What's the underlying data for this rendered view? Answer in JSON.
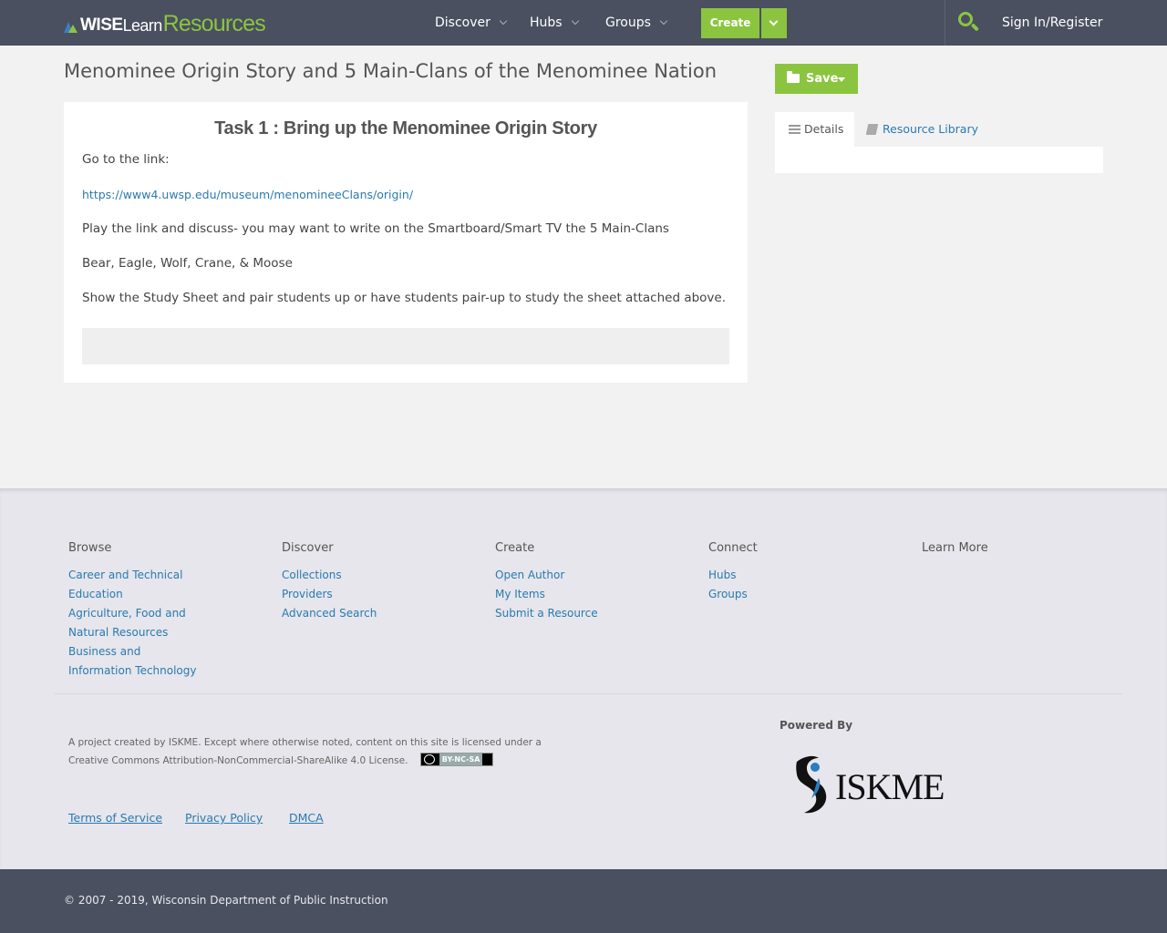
{
  "header": {
    "logo": {
      "wise": "WISE",
      "learn": "Learn",
      "resources": "Resources"
    },
    "nav": [
      {
        "label": "Discover"
      },
      {
        "label": "Hubs"
      },
      {
        "label": "Groups"
      }
    ],
    "create_label": "Create",
    "signin_label": "Sign In/Register"
  },
  "main": {
    "title": "Menominee Origin Story and 5 Main-Clans of the Menominee Nation",
    "task_title": "Task 1 : Bring up the Menominee Origin Story",
    "paragraphs": [
      "Go to the link:",
      "https://www4.uwsp.edu/museum/menomineeClans/origin/",
      "Play the link and discuss- you may want to write on the Smartboard/Smart TV the 5 Main-Clans",
      "Bear, Eagle, Wolf, Crane, & Moose",
      "Show the Study Sheet and pair students up or have students pair-up to study the sheet attached above."
    ]
  },
  "sidebar": {
    "save_label": "Save",
    "tabs": [
      {
        "label": "Details"
      },
      {
        "label": "Resource Library"
      }
    ]
  },
  "footer": {
    "columns": [
      {
        "heading": "Browse",
        "links": [
          "Career and Technical Education",
          "Agriculture, Food and Natural Resources",
          "Business and Information Technology"
        ]
      },
      {
        "heading": "Discover",
        "links": [
          "Collections",
          "Providers",
          "Advanced Search"
        ]
      },
      {
        "heading": "Create",
        "links": [
          "Open Author",
          "My Items",
          "Submit a Resource"
        ]
      },
      {
        "heading": "Connect",
        "links": [
          "Hubs",
          "Groups"
        ]
      },
      {
        "heading": "Learn More",
        "links": []
      }
    ],
    "license_text": "A project created by ISKME. Except where otherwise noted, content on this site is licensed under a Creative Commons Attribution-NonCommercial-ShareAlike 4.0 License.",
    "cc_badge": "BY-NC-SA",
    "links": [
      "Terms of Service",
      "Privacy Policy",
      "DMCA"
    ],
    "powered_by": "Powered By",
    "iskme_logo": "ISKME",
    "copyright": "© 2007 - 2019, Wisconsin Department of Public Instruction"
  },
  "colors": {
    "header_bg": "#4a5060",
    "accent_green": "#8bc53f",
    "link_blue": "#2a7ab0",
    "footer_bg": "#e6e6ec"
  }
}
